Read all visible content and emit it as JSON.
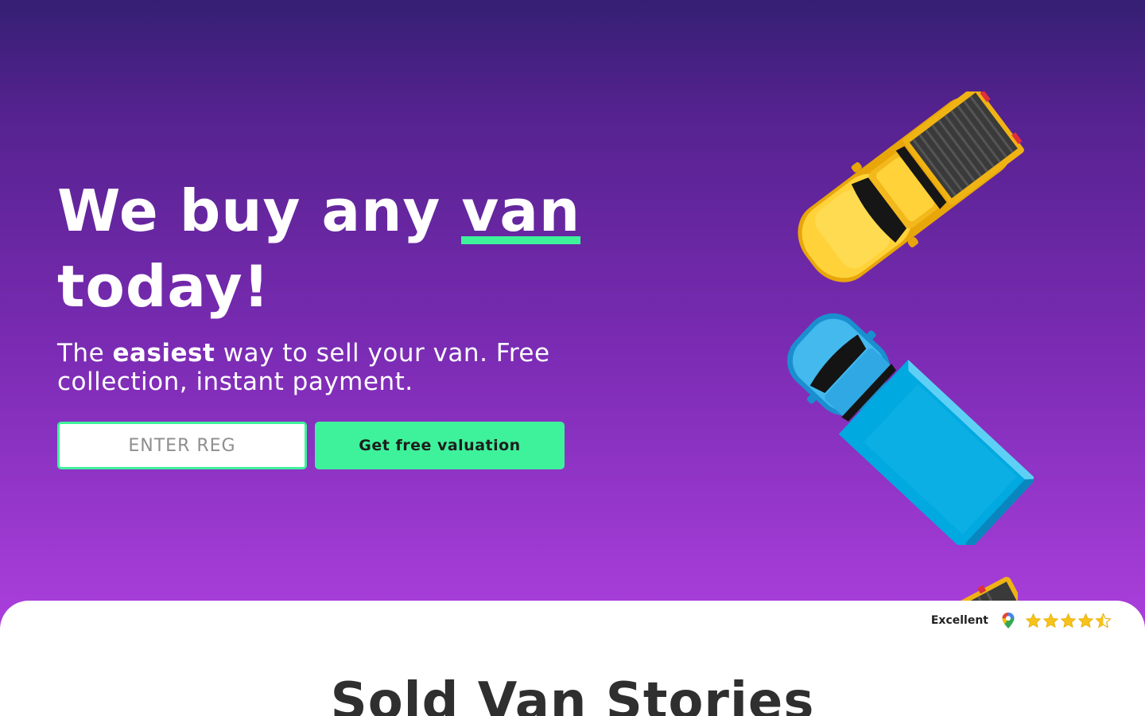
{
  "hero": {
    "headline_before": "We buy any ",
    "headline_highlight": "van",
    "headline_after": "today!",
    "subtitle_pre": "The ",
    "subtitle_bold": "easiest",
    "subtitle_post": " way to sell your van. Free collection, instant payment.",
    "reg_placeholder": "ENTER REG",
    "cta_label": "Get free valuation"
  },
  "illustrations": [
    "yellow-pickup-truck",
    "blue-box-van",
    "yellow-pickup-truck"
  ],
  "rating": {
    "label": "Excellent",
    "source_icon": "google-maps-pin-icon",
    "stars": 4.5,
    "max": 5
  },
  "section": {
    "title": "Sold Van Stories"
  },
  "colors": {
    "accent": "#3ef29b",
    "hero_top": "#351f73",
    "hero_bottom": "#ab3fdc",
    "star": "#f7c21a"
  }
}
